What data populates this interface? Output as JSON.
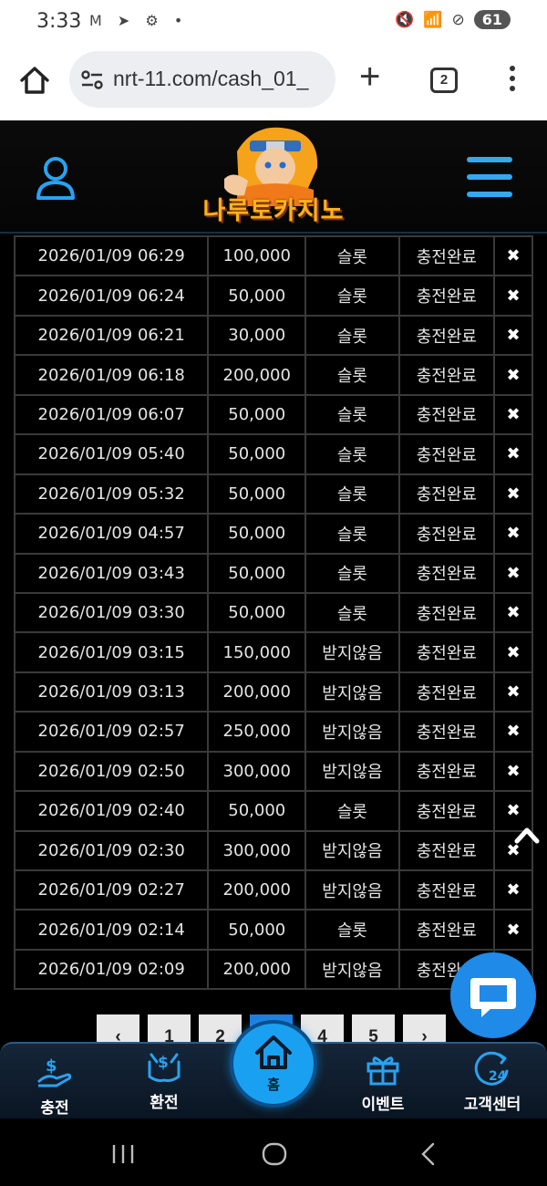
{
  "status_bar": {
    "time": "3:33",
    "left_icons": "M ➤ ⚙ •",
    "battery": "61"
  },
  "browser": {
    "url": "nrt-11.com/cash_01_",
    "tab_count": "2"
  },
  "site": {
    "logo_text": "나루토카지노"
  },
  "table": {
    "rows": [
      {
        "date": "2026/01/09 06:29",
        "amount": "100,000",
        "type": "슬롯",
        "status": "충전완료",
        "del": "✖"
      },
      {
        "date": "2026/01/09 06:24",
        "amount": "50,000",
        "type": "슬롯",
        "status": "충전완료",
        "del": "✖"
      },
      {
        "date": "2026/01/09 06:21",
        "amount": "30,000",
        "type": "슬롯",
        "status": "충전완료",
        "del": "✖"
      },
      {
        "date": "2026/01/09 06:18",
        "amount": "200,000",
        "type": "슬롯",
        "status": "충전완료",
        "del": "✖"
      },
      {
        "date": "2026/01/09 06:07",
        "amount": "50,000",
        "type": "슬롯",
        "status": "충전완료",
        "del": "✖"
      },
      {
        "date": "2026/01/09 05:40",
        "amount": "50,000",
        "type": "슬롯",
        "status": "충전완료",
        "del": "✖"
      },
      {
        "date": "2026/01/09 05:32",
        "amount": "50,000",
        "type": "슬롯",
        "status": "충전완료",
        "del": "✖"
      },
      {
        "date": "2026/01/09 04:57",
        "amount": "50,000",
        "type": "슬롯",
        "status": "충전완료",
        "del": "✖"
      },
      {
        "date": "2026/01/09 03:43",
        "amount": "50,000",
        "type": "슬롯",
        "status": "충전완료",
        "del": "✖"
      },
      {
        "date": "2026/01/09 03:30",
        "amount": "50,000",
        "type": "슬롯",
        "status": "충전완료",
        "del": "✖"
      },
      {
        "date": "2026/01/09 03:15",
        "amount": "150,000",
        "type": "받지않음",
        "status": "충전완료",
        "del": "✖"
      },
      {
        "date": "2026/01/09 03:13",
        "amount": "200,000",
        "type": "받지않음",
        "status": "충전완료",
        "del": "✖"
      },
      {
        "date": "2026/01/09 02:57",
        "amount": "250,000",
        "type": "받지않음",
        "status": "충전완료",
        "del": "✖"
      },
      {
        "date": "2026/01/09 02:50",
        "amount": "300,000",
        "type": "받지않음",
        "status": "충전완료",
        "del": "✖"
      },
      {
        "date": "2026/01/09 02:40",
        "amount": "50,000",
        "type": "슬롯",
        "status": "충전완료",
        "del": "✖"
      },
      {
        "date": "2026/01/09 02:30",
        "amount": "300,000",
        "type": "받지않음",
        "status": "충전완료",
        "del": "✖"
      },
      {
        "date": "2026/01/09 02:27",
        "amount": "200,000",
        "type": "받지않음",
        "status": "충전완료",
        "del": "✖"
      },
      {
        "date": "2026/01/09 02:14",
        "amount": "50,000",
        "type": "슬롯",
        "status": "충전완료",
        "del": "✖"
      },
      {
        "date": "2026/01/09 02:09",
        "amount": "200,000",
        "type": "받지않음",
        "status": "충전완료",
        "del": "✖"
      }
    ]
  },
  "pagination": {
    "prev": "‹",
    "pages": [
      "1",
      "2",
      "3",
      "4",
      "5"
    ],
    "active_page": "3",
    "next": "›"
  },
  "bottom_nav": {
    "deposit": "충전",
    "withdraw": "환전",
    "home": "홈",
    "event": "이벤트",
    "support": "고객센터"
  },
  "colors": {
    "accent": "#1f8ae8",
    "logo": "#ffb21a",
    "nav_bg": "#15263a"
  }
}
